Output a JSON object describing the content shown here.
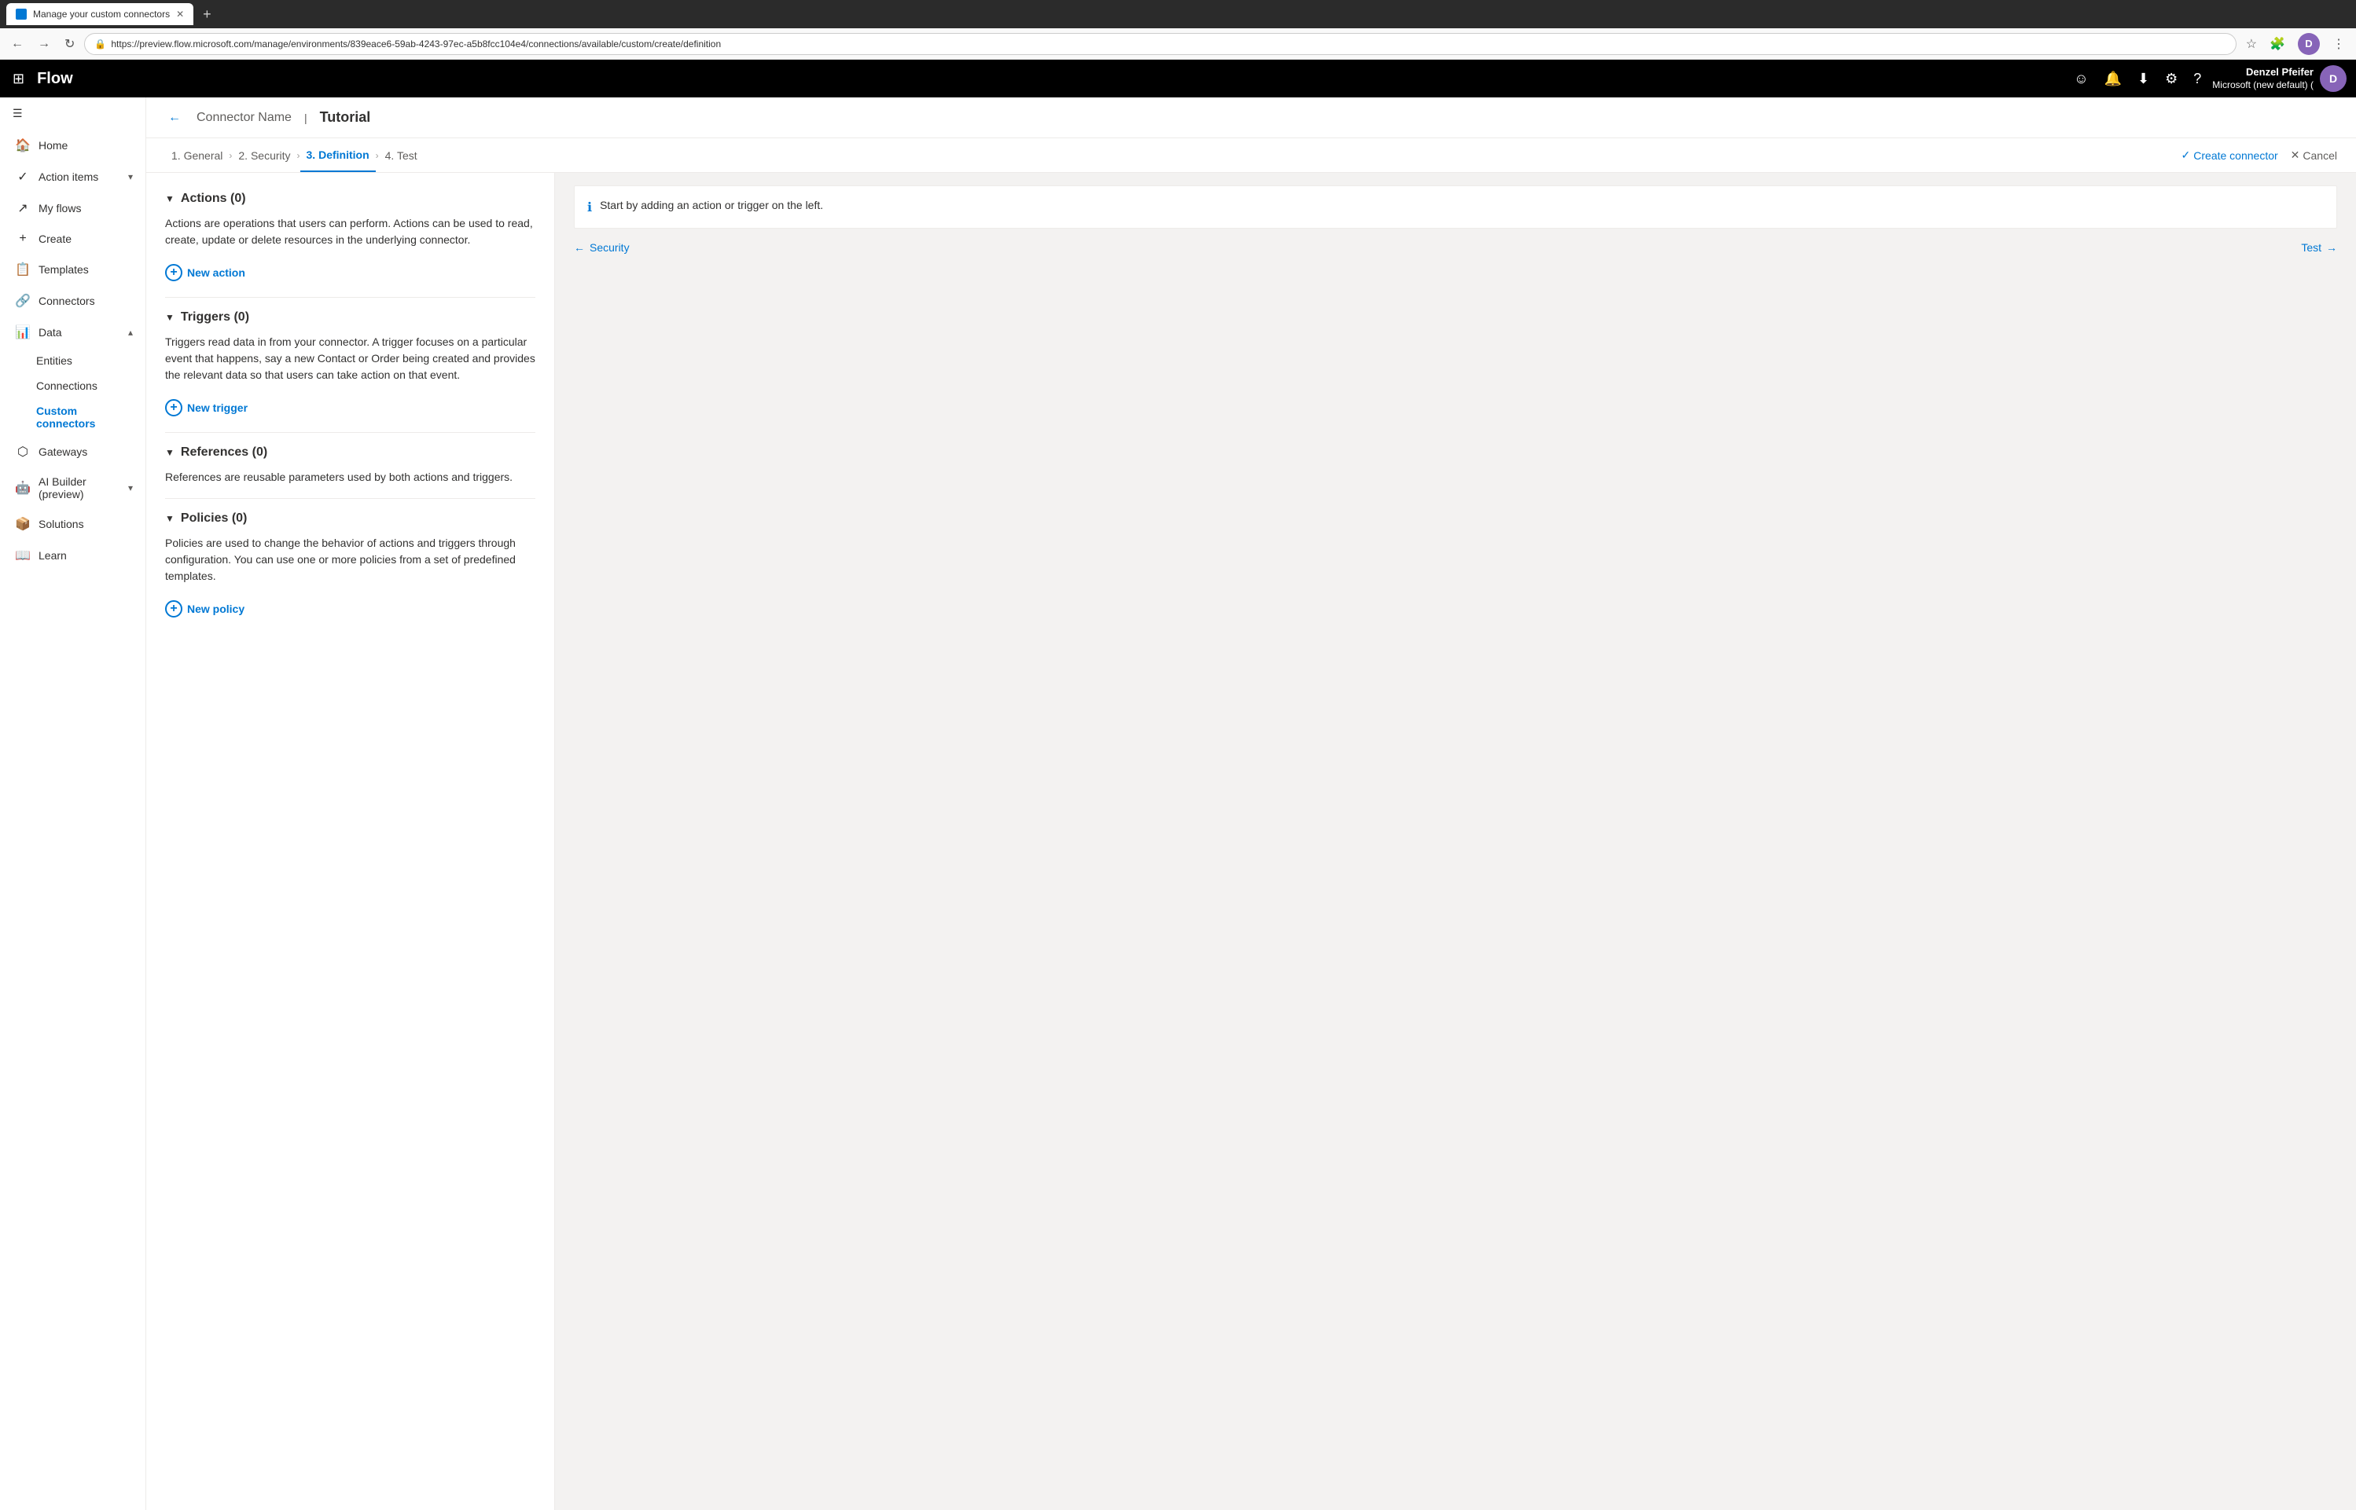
{
  "browser": {
    "tab_title": "Manage your custom connectors",
    "url": "https://preview.flow.microsoft.com/manage/environments/839eace6-59ab-4243-97ec-a5b8fcc104e4/connections/available/custom/create/definition",
    "new_tab_icon": "+",
    "back_icon": "←",
    "forward_icon": "→",
    "refresh_icon": "↻",
    "lock_icon": "🔒",
    "user_initial": "D"
  },
  "topbar": {
    "app_name": "Flow",
    "waffle_icon": "⊞",
    "emoji_icon": "☺",
    "bell_icon": "🔔",
    "download_icon": "⬇",
    "settings_icon": "⚙",
    "help_icon": "?",
    "user_name": "Denzel Pfeifer",
    "user_org": "Microsoft (new default) (",
    "user_initial": "D"
  },
  "sidebar": {
    "hamburger_icon": "☰",
    "items": [
      {
        "id": "home",
        "label": "Home",
        "icon": "🏠",
        "active": false
      },
      {
        "id": "action-items",
        "label": "Action items",
        "icon": "✓",
        "active": false,
        "has_chevron": true,
        "expanded": false
      },
      {
        "id": "my-flows",
        "label": "My flows",
        "icon": "↗",
        "active": false
      },
      {
        "id": "create",
        "label": "Create",
        "icon": "+",
        "active": false
      },
      {
        "id": "templates",
        "label": "Templates",
        "icon": "📋",
        "active": false
      },
      {
        "id": "connectors",
        "label": "Connectors",
        "icon": "🔗",
        "active": false
      },
      {
        "id": "data",
        "label": "Data",
        "icon": "📊",
        "active": false,
        "has_chevron": true,
        "expanded": true
      }
    ],
    "sub_items": [
      {
        "id": "entities",
        "label": "Entities",
        "active": false
      },
      {
        "id": "connections",
        "label": "Connections",
        "active": false
      },
      {
        "id": "custom-connectors",
        "label": "Custom connectors",
        "active": true
      }
    ],
    "bottom_items": [
      {
        "id": "gateways",
        "label": "Gateways",
        "icon": "⬡",
        "active": false
      },
      {
        "id": "ai-builder",
        "label": "AI Builder (preview)",
        "icon": "🤖",
        "active": false,
        "has_chevron": true
      },
      {
        "id": "solutions",
        "label": "Solutions",
        "icon": "📦",
        "active": false
      },
      {
        "id": "learn",
        "label": "Learn",
        "icon": "📖",
        "active": false
      }
    ]
  },
  "page_header": {
    "back_icon": "←",
    "connector_name_label": "Connector Name",
    "separator": "|",
    "tutorial_label": "Tutorial"
  },
  "steps": [
    {
      "id": "general",
      "label": "1. General",
      "active": false
    },
    {
      "id": "security",
      "label": "2. Security",
      "active": false
    },
    {
      "id": "definition",
      "label": "3. Definition",
      "active": true
    },
    {
      "id": "test",
      "label": "4. Test",
      "active": false
    }
  ],
  "steps_actions": {
    "create_icon": "✓",
    "create_label": "Create connector",
    "cancel_icon": "✕",
    "cancel_label": "Cancel"
  },
  "definition": {
    "actions_section": {
      "chevron": "▼",
      "title": "Actions (0)",
      "description": "Actions are operations that users can perform. Actions can be used to read, create, update or delete resources in the underlying connector.",
      "new_action_label": "New action"
    },
    "triggers_section": {
      "chevron": "▼",
      "title": "Triggers (0)",
      "description": "Triggers read data in from your connector. A trigger focuses on a particular event that happens, say a new Contact or Order being created and provides the relevant data so that users can take action on that event.",
      "new_trigger_label": "New trigger"
    },
    "references_section": {
      "chevron": "▼",
      "title": "References (0)",
      "description": "References are reusable parameters used by both actions and triggers."
    },
    "policies_section": {
      "chevron": "▼",
      "title": "Policies (0)",
      "description": "Policies are used to change the behavior of actions and triggers through configuration. You can use one or more policies from a set of predefined templates.",
      "new_policy_label": "New policy"
    }
  },
  "right_panel": {
    "info_icon": "ℹ",
    "info_text": "Start by adding an action or trigger on the left.",
    "nav_back_icon": "←",
    "nav_back_label": "Security",
    "nav_forward_icon": "→",
    "nav_forward_label": "Test"
  },
  "colors": {
    "accent": "#0078d4",
    "active_sidebar": "#0078d4",
    "black": "#000",
    "text_primary": "#323130",
    "text_secondary": "#605e5c"
  }
}
